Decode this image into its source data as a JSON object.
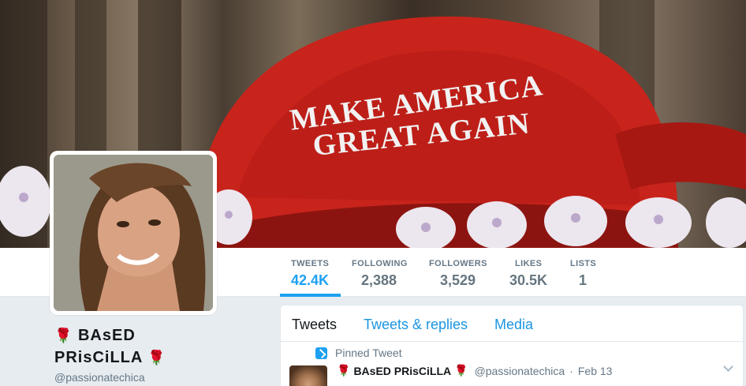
{
  "banner": {
    "cap_line1": "MAKE AMERICA",
    "cap_line2": "GREAT AGAIN"
  },
  "stats": [
    {
      "label": "TWEETS",
      "value": "42.4K"
    },
    {
      "label": "FOLLOWING",
      "value": "2,388"
    },
    {
      "label": "FOLLOWERS",
      "value": "3,529"
    },
    {
      "label": "LIKES",
      "value": "30.5K"
    },
    {
      "label": "LISTS",
      "value": "1"
    }
  ],
  "profile": {
    "name_line1": "BAsED",
    "name_line2": "PRisCiLLA",
    "rose": "🌹",
    "handle": "@passionatechica"
  },
  "timeline": {
    "tabs": [
      "Tweets",
      "Tweets & replies",
      "Media"
    ],
    "pinned_label": "Pinned Tweet",
    "tweet": {
      "name": "BAsED PRisCiLLA",
      "handle": "@passionatechica",
      "separator": "·",
      "date": "Feb 13"
    }
  },
  "colors": {
    "accent": "#1da1f2",
    "tab_blue": "#1b95e0",
    "cap_red": "#c8241c"
  }
}
